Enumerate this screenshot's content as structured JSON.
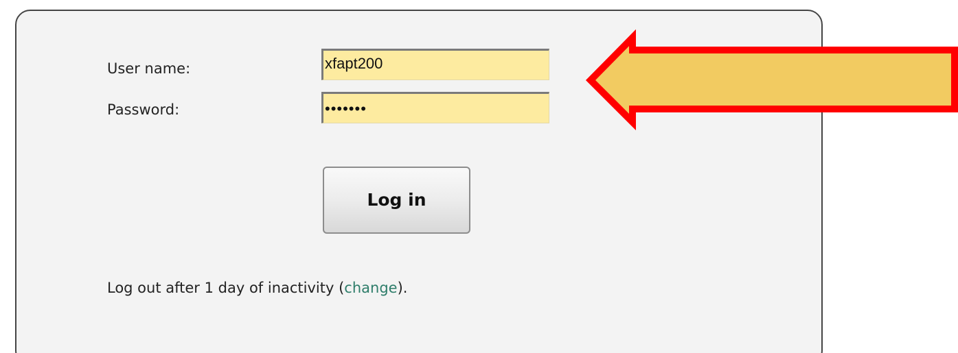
{
  "form": {
    "username_label": "User name:",
    "username_value": "xfapt200",
    "password_label": "Password:",
    "password_mask": "•••••••",
    "login_button": "Log in"
  },
  "footer": {
    "prefix": "Log out after 1 day of inactivity (",
    "change_link": "change",
    "suffix": ")."
  },
  "annotation": {
    "arrow_fill": "#f2cb61",
    "arrow_stroke": "#ff0000"
  }
}
